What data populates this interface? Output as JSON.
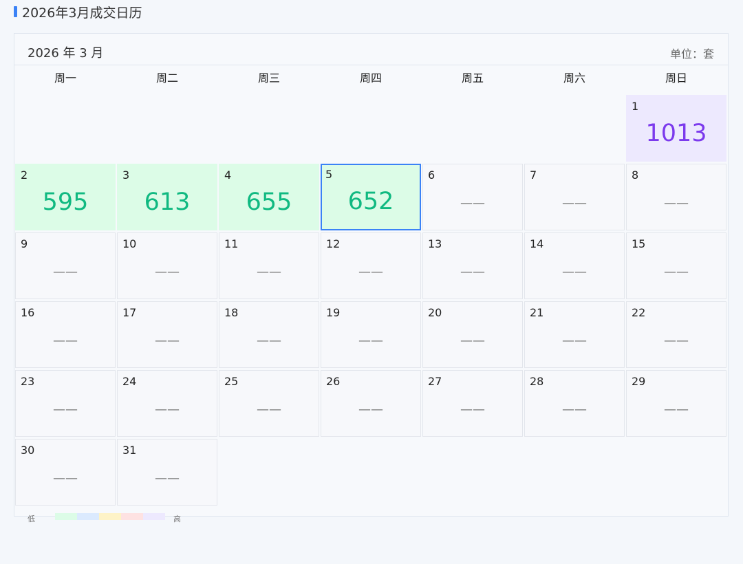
{
  "page": {
    "title": "2026年3月成交日历"
  },
  "calendar": {
    "month_label": "2026 年 3 月",
    "unit_label": "单位：套",
    "weekdays": [
      "周一",
      "周二",
      "周三",
      "周四",
      "周五",
      "周六",
      "周日"
    ],
    "empty_mark": "——",
    "first_weekday_index": 6,
    "today": 5,
    "days": [
      {
        "day": "1",
        "value": "1013",
        "level": "high"
      },
      {
        "day": "2",
        "value": "595",
        "level": "data"
      },
      {
        "day": "3",
        "value": "613",
        "level": "data"
      },
      {
        "day": "4",
        "value": "655",
        "level": "data"
      },
      {
        "day": "5",
        "value": "652",
        "level": "data"
      },
      {
        "day": "6",
        "value": null,
        "level": "none"
      },
      {
        "day": "7",
        "value": null,
        "level": "none"
      },
      {
        "day": "8",
        "value": null,
        "level": "none"
      },
      {
        "day": "9",
        "value": null,
        "level": "none"
      },
      {
        "day": "10",
        "value": null,
        "level": "none"
      },
      {
        "day": "11",
        "value": null,
        "level": "none"
      },
      {
        "day": "12",
        "value": null,
        "level": "none"
      },
      {
        "day": "13",
        "value": null,
        "level": "none"
      },
      {
        "day": "14",
        "value": null,
        "level": "none"
      },
      {
        "day": "15",
        "value": null,
        "level": "none"
      },
      {
        "day": "16",
        "value": null,
        "level": "none"
      },
      {
        "day": "17",
        "value": null,
        "level": "none"
      },
      {
        "day": "18",
        "value": null,
        "level": "none"
      },
      {
        "day": "19",
        "value": null,
        "level": "none"
      },
      {
        "day": "20",
        "value": null,
        "level": "none"
      },
      {
        "day": "21",
        "value": null,
        "level": "none"
      },
      {
        "day": "22",
        "value": null,
        "level": "none"
      },
      {
        "day": "23",
        "value": null,
        "level": "none"
      },
      {
        "day": "24",
        "value": null,
        "level": "none"
      },
      {
        "day": "25",
        "value": null,
        "level": "none"
      },
      {
        "day": "26",
        "value": null,
        "level": "none"
      },
      {
        "day": "27",
        "value": null,
        "level": "none"
      },
      {
        "day": "28",
        "value": null,
        "level": "none"
      },
      {
        "day": "29",
        "value": null,
        "level": "none"
      },
      {
        "day": "30",
        "value": null,
        "level": "none"
      },
      {
        "day": "31",
        "value": null,
        "level": "none"
      }
    ]
  },
  "legend": {
    "low_label": "低",
    "high_label": "高",
    "colors": [
      "#dcfce7",
      "#dbeafe",
      "#fef3c7",
      "#fee2e2",
      "#ede9fe"
    ]
  },
  "colors": {
    "accent": "#3b82f6",
    "value_green": "#10b981",
    "value_purple": "#7c3aed"
  }
}
